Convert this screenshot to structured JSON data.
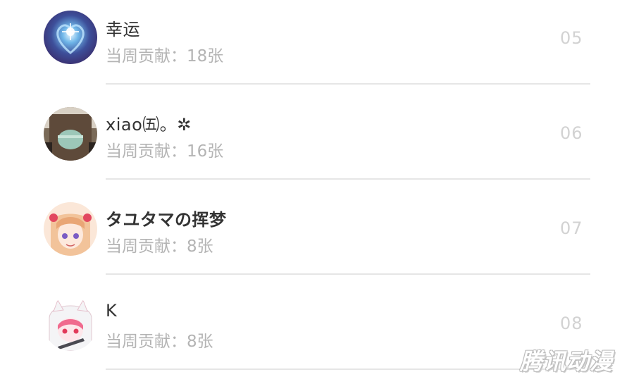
{
  "contribution_list": [
    {
      "name": "幸运",
      "contribution": "当周贡献：18张",
      "rank": "05",
      "avatar": "avatar-blue-heart"
    },
    {
      "name": "xiao㈤。✲",
      "contribution": "当周贡献：16张",
      "rank": "06",
      "avatar": "avatar-photo"
    },
    {
      "name": "タユタマの挥梦",
      "contribution": "当周贡献：8张",
      "rank": "07",
      "avatar": "avatar-anime-girl"
    },
    {
      "name": "K",
      "contribution": "当周贡献：8张",
      "rank": "08",
      "avatar": "avatar-anime-pink-hood"
    }
  ],
  "watermark": "腾讯动漫"
}
